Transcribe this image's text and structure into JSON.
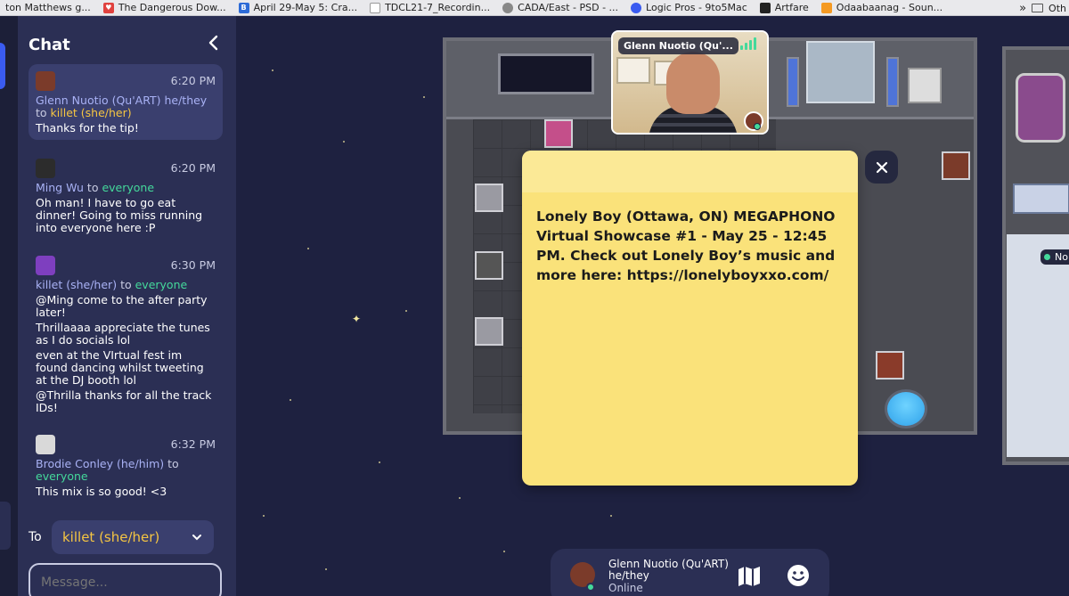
{
  "bookmarks": [
    {
      "label": "ton Matthews g...",
      "icon": "none"
    },
    {
      "label": "The Dangerous Dow...",
      "icon": "heart-icon",
      "color": "#e0423f"
    },
    {
      "label": "April 29-May 5: Cra...",
      "icon": "b-logo-icon",
      "color": "#2d6bd7"
    },
    {
      "label": "TDCL21-7_Recordin...",
      "icon": "page-icon",
      "color": "#777"
    },
    {
      "label": "CADA/East - PSD - ...",
      "icon": "globe-icon",
      "color": "#666"
    },
    {
      "label": "Logic Pros - 9to5Mac",
      "icon": "clock-icon",
      "color": "#3a5bf0"
    },
    {
      "label": "Artfare",
      "icon": "artfare-icon",
      "color": "#222"
    },
    {
      "label": "Odaabaanag - Soun...",
      "icon": "soundcloud-icon",
      "color": "#f59a23"
    }
  ],
  "bookmarks_overflow": "Oth",
  "chat": {
    "title": "Chat",
    "messages": [
      {
        "time": "6:20 PM",
        "from": "Glenn Nuotio (Qu'ART) he/they",
        "to_word": "to",
        "to": "killet (she/her)",
        "to_type": "user",
        "lines": [
          "Thanks for the tip!"
        ],
        "highlight": true,
        "avatar_color": "#7b3b2a"
      },
      {
        "time": "6:20 PM",
        "from": "Ming Wu",
        "to_word": "to",
        "to": "everyone",
        "to_type": "all",
        "lines": [
          "Oh man! I have to go eat dinner! Going to miss running into everyone here :P"
        ],
        "highlight": false,
        "avatar_color": "#2c2c2c"
      },
      {
        "time": "6:30 PM",
        "from": "killet (she/her)",
        "to_word": "to",
        "to": "everyone",
        "to_type": "all",
        "lines": [
          "@Ming come to the after party later!",
          "Thrillaaaa appreciate the tunes as I do socials lol",
          "even at the VIrtual fest im found dancing whilst tweeting at the DJ booth lol",
          "@Thrilla thanks for all the track IDs!"
        ],
        "highlight": false,
        "avatar_color": "#7e3fbf"
      },
      {
        "time": "6:32 PM",
        "from": "Brodie Conley (he/him)",
        "to_word": "to",
        "to": "everyone",
        "to_type": "all",
        "lines": [
          "This mix is so good! <3"
        ],
        "highlight": false,
        "avatar_color": "#d9d9d9"
      }
    ],
    "to_label": "To",
    "to_selected": "killet (she/her)",
    "message_placeholder": "Message..."
  },
  "video": {
    "name": "Glenn Nuotio (Qu'...",
    "signal_bars": 4
  },
  "note": {
    "text": "Lonely Boy (Ottawa, ON) MEGAPHONO Virtual Showcase #1 - May 25 - 12:45 PM. Check out Lonely Boy’s music and more here: https://lonelyboyxxo.com/"
  },
  "status_bar": {
    "name": "Glenn Nuotio (Qu'ART) he/they",
    "status": "Online"
  },
  "map_name_tag": "Nor",
  "colors": {
    "accent": "#3a5bf0",
    "online": "#44d99b",
    "user_target": "#f5c542",
    "note_bg": "#fae27a"
  }
}
